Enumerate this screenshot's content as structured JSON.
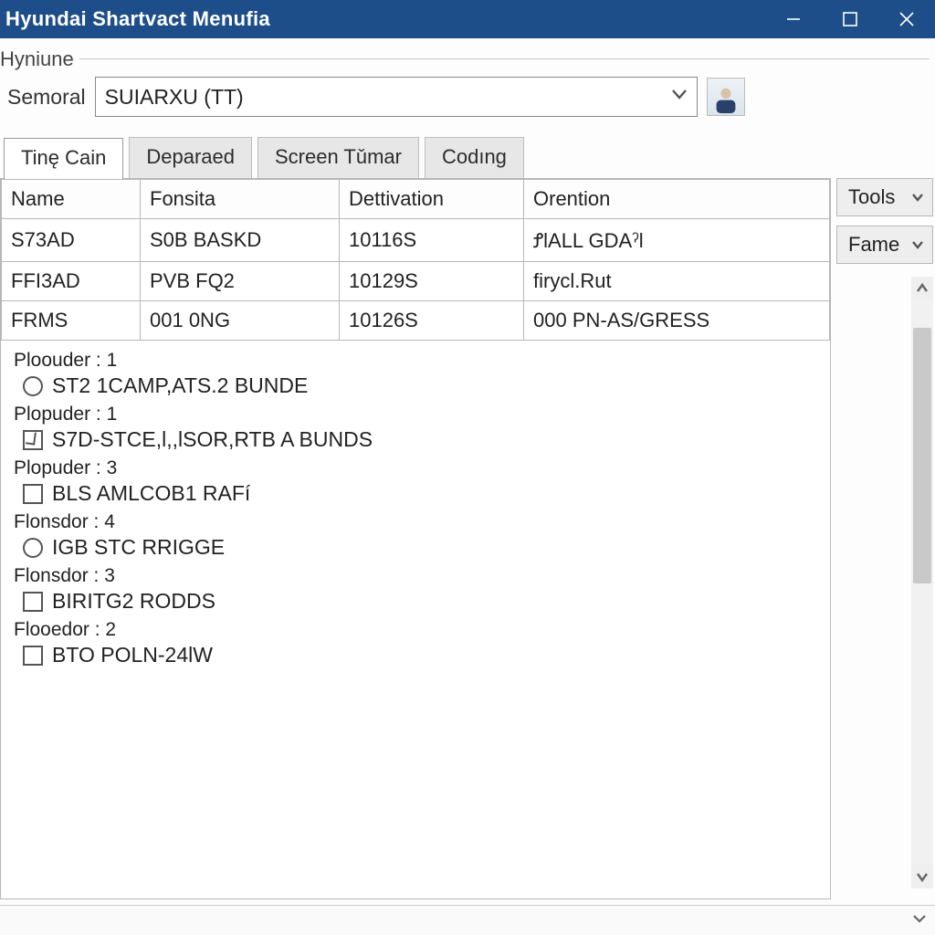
{
  "window": {
    "title": "Hyundai Shartvact Menufia"
  },
  "group": {
    "label": "Hyniune",
    "field_label": "Semoral",
    "combo_value": "SUIARXU (TT)"
  },
  "tabs": [
    {
      "label": "Tinę Cain",
      "active": true
    },
    {
      "label": "Deparaed"
    },
    {
      "label": "Screen Tǔmar"
    },
    {
      "label": "Codıng"
    }
  ],
  "grid": {
    "headers": [
      "Name",
      "Fonsita",
      "Dettivation",
      "Orention"
    ],
    "rows": [
      [
        "S73AD",
        "S0B BASKD",
        "10116S",
        "ꝬlALL GDAˀl"
      ],
      [
        "FFI3AD",
        "PVB FQ2",
        "10129S",
        "firycl.Rut"
      ],
      [
        "FRMS",
        "001 0NG",
        "10126S",
        "000 PN-AS/GRESS"
      ]
    ]
  },
  "options": [
    {
      "group": "Ploouder :  1",
      "type": "radio",
      "checked": false,
      "label": "ST2 1CAMP,ATS.2 BUNDE"
    },
    {
      "group": "Plopuder :  1",
      "type": "checkbox",
      "checked": true,
      "partial": true,
      "label": "S7D-STCE,l,,lSOR,RTB A BUNDS"
    },
    {
      "group": "Plopuder :  3",
      "type": "checkbox",
      "checked": false,
      "label": "BLS AMLCOB1 RAFí"
    },
    {
      "group": "Flonsdor :  4",
      "type": "radio",
      "checked": false,
      "label": "IGB STC RRIGGE"
    },
    {
      "group": "Flonsdor :  3",
      "type": "checkbox",
      "checked": false,
      "label": "BIRITG2 RODDS"
    },
    {
      "group": "Flooedor :  2",
      "type": "checkbox",
      "checked": false,
      "label": "BTO POLN-24lW"
    }
  ],
  "side": {
    "tools": "Tools",
    "fame": "Fame"
  }
}
